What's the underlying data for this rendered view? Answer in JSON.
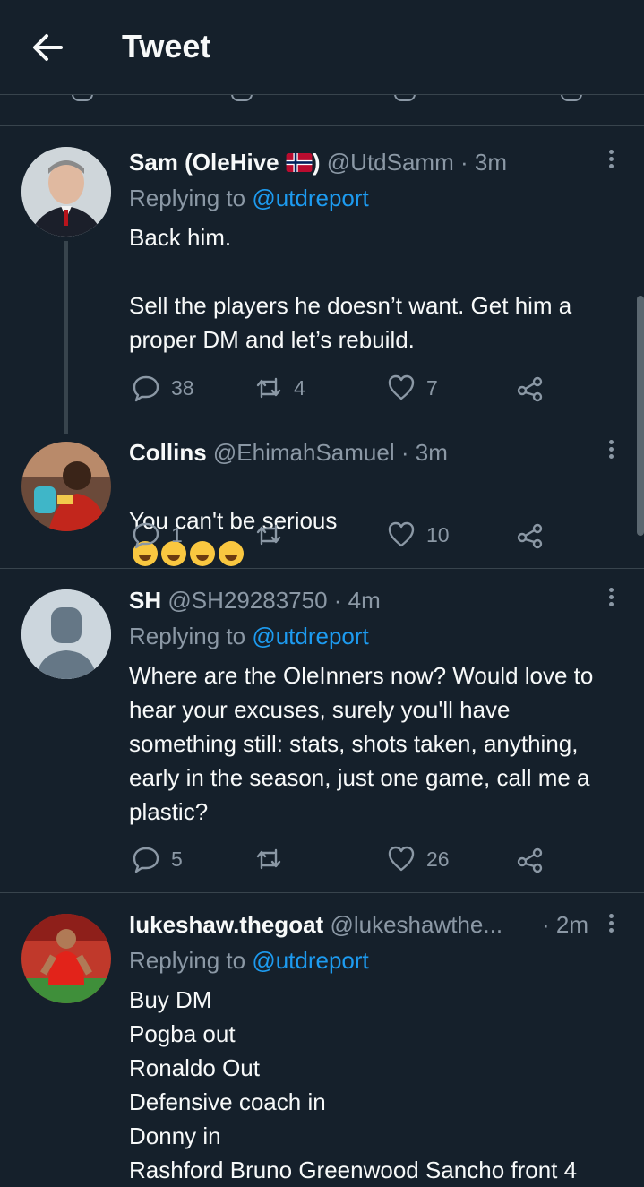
{
  "header": {
    "title": "Tweet",
    "back_icon": "arrow-left-icon"
  },
  "colors": {
    "background": "#15202b",
    "link": "#1d9bf0",
    "muted": "#8b98a5",
    "divider": "#38444d"
  },
  "tweets": [
    {
      "name": "Sam (OleHive",
      "name_suffix": ")",
      "flag": "norway-flag",
      "handle": "@UtdSamm",
      "time": "· 3m",
      "replying_prefix": "Replying to ",
      "replying_to": "@utdreport",
      "text": "Back him.\n\nSell the players he doesn’t want. Get him a proper DM and let’s rebuild.",
      "replies": "38",
      "retweets": "4",
      "likes": "7"
    },
    {
      "name": "Collins",
      "handle": "@EhimahSamuel",
      "time": "· 3m",
      "text": "You can't be serious",
      "emoji": "rolling-laughing-emoji x4",
      "replies": "1",
      "retweets": "",
      "likes": "10"
    },
    {
      "name": "SH",
      "handle": "@SH29283750",
      "time": "· 4m",
      "replying_prefix": "Replying to ",
      "replying_to": "@utdreport",
      "text": "Where are the OleInners now? Would love to hear your excuses, surely you'll have something still: stats, shots taken, anything, early in the season, just one game, call me a plastic?",
      "replies": "5",
      "retweets": "",
      "likes": "26"
    },
    {
      "name": "lukeshaw.thegoat",
      "handle": "@lukeshawthe...",
      "time": "· 2m",
      "replying_prefix": "Replying to ",
      "replying_to": "@utdreport",
      "text": "Buy DM\nPogba out\nRonaldo Out\nDefensive coach in\nDonny in\nRashford Bruno Greenwood Sancho front 4"
    }
  ]
}
